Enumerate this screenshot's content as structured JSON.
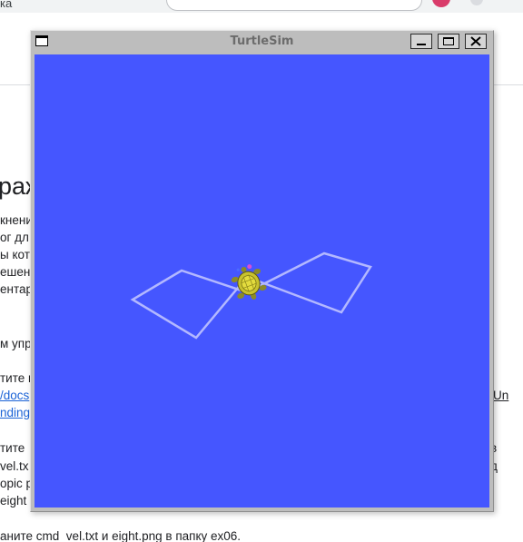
{
  "browser": {
    "tab_text": "ка"
  },
  "page": {
    "heading": "раж",
    "lines": [
      "кнени",
      "ог дл",
      "ы кот",
      "ешенн",
      "ентар",
      "м упр",
      "тите и",
      "/docs",
      "nding",
      "тите",
      "vel.tx",
      "opic p",
      "eight",
      "аните cmd_vel.txt и eight.png в папку ex06."
    ],
    "right_fragments": [
      "Un",
      "в",
      "д"
    ]
  },
  "window": {
    "title": "TurtleSim",
    "background_color": "#4556ff",
    "trail_color": "#b3b8ff",
    "buttons": [
      "minimize",
      "maximize",
      "close"
    ]
  }
}
